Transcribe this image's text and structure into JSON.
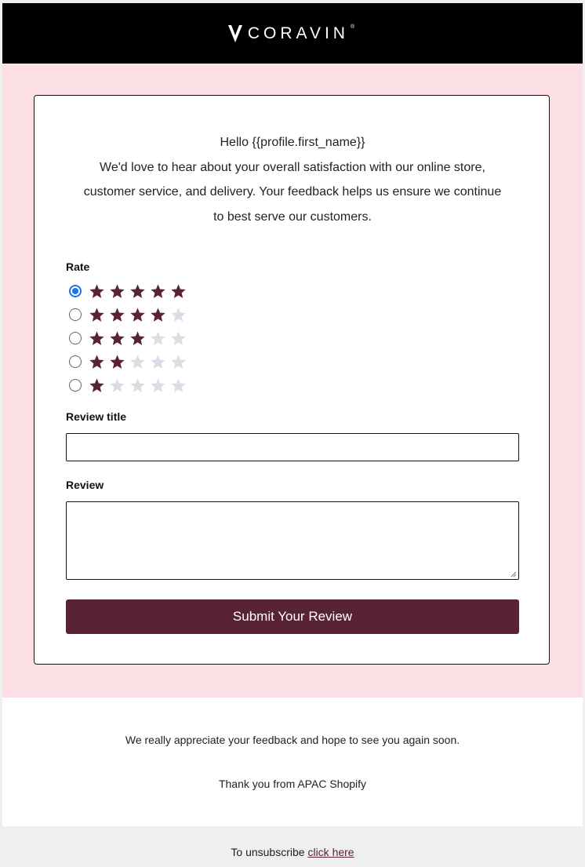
{
  "header": {
    "logo_text": "CORAVIN",
    "logo_mark": "®",
    "logo_icon": "coravin-v-icon"
  },
  "colors": {
    "accent": "#5a2333",
    "pink_bg": "#fbdfe4",
    "star_filled": "#5a2333",
    "star_empty": "#dcdce6",
    "radio_selected": "#1a73e8"
  },
  "form": {
    "greeting": "Hello {{profile.first_name}}",
    "intro": "We'd love to hear about your overall satisfaction with our online store, customer service, and delivery. Your feedback helps us ensure we continue to best serve our customers.",
    "rate_label": "Rate",
    "rating_options": [
      {
        "stars": 5,
        "selected": true
      },
      {
        "stars": 4,
        "selected": false
      },
      {
        "stars": 3,
        "selected": false
      },
      {
        "stars": 2,
        "selected": false
      },
      {
        "stars": 1,
        "selected": false
      }
    ],
    "max_stars": 5,
    "title_label": "Review title",
    "title_value": "",
    "review_label": "Review",
    "review_value": "",
    "submit_label": "Submit Your Review"
  },
  "footer": {
    "appreciation": "We really appreciate your feedback and hope to see you again soon.",
    "thanks": "Thank you from APAC Shopify",
    "unsubscribe_text": "To unsubscribe",
    "unsubscribe_link": "click here"
  }
}
